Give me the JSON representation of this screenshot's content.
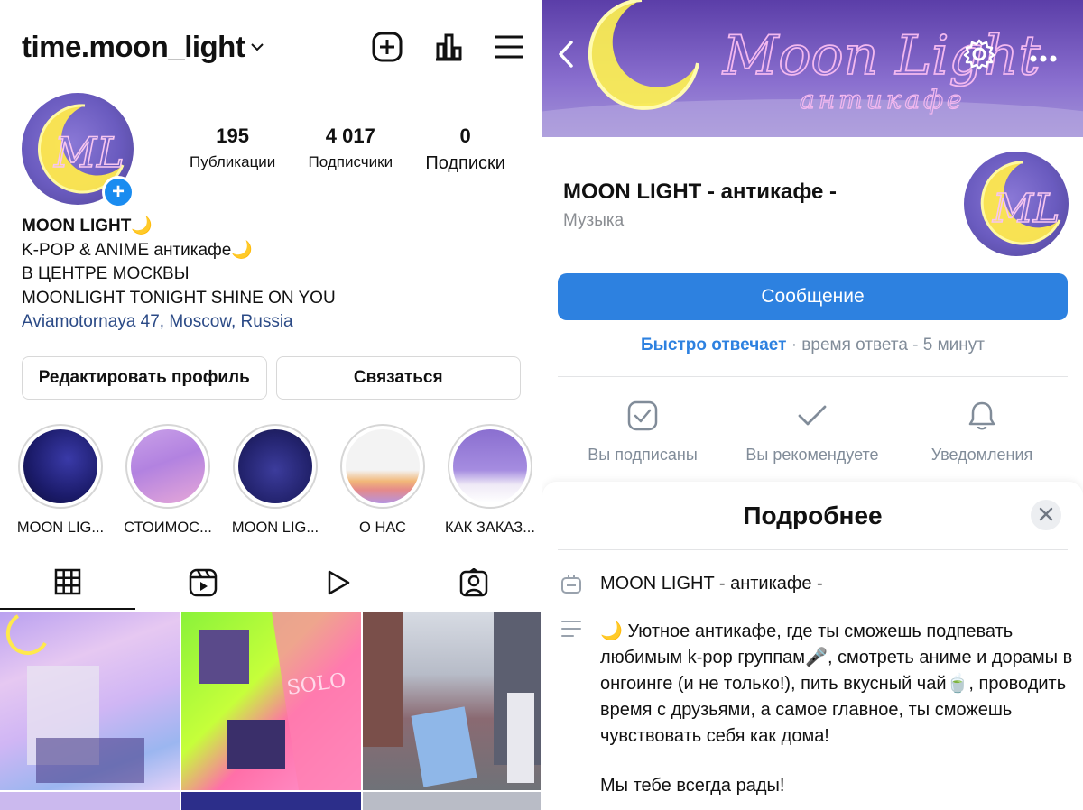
{
  "instagram": {
    "username": "time.moon_light",
    "stats": [
      {
        "value": "195",
        "label": "Публикации"
      },
      {
        "value": "4 017",
        "label": "Подписчики"
      },
      {
        "value": "0",
        "label": "Подписки"
      }
    ],
    "bio": {
      "name": "MOON LIGHT🌙",
      "line1": "K-POP & ANIME антикафе🌙",
      "line2": "В ЦЕНТРЕ МОСКВЫ",
      "line3": "MOONLIGHT TONIGHT SHINE ON YOU",
      "location": "Aviamotornaya 47, Moscow, Russia"
    },
    "buttons": {
      "edit": "Редактировать профиль",
      "contact": "Связаться"
    },
    "highlights": [
      {
        "title": "MOON LIG..."
      },
      {
        "title": "СТОИМОС..."
      },
      {
        "title": "MOON LIG..."
      },
      {
        "title": "О НАС"
      },
      {
        "title": "КАК ЗАКАЗ..."
      }
    ],
    "avatar_letters": "ML",
    "grid_texts": {
      "solo": "SOLO"
    }
  },
  "vk": {
    "cover_text": "Moon Light",
    "cover_sub": "антикафе",
    "name": "MOON LIGHT - антикафе -",
    "category": "Музыка",
    "message_button": "Сообщение",
    "reply_fast": "Быстро отвечает",
    "reply_time": " · время ответа - 5 минут",
    "actions": [
      {
        "label": "Вы подписаны",
        "icon": "check-square-icon"
      },
      {
        "label": "Вы рекомендуете",
        "icon": "check-icon"
      },
      {
        "label": "Уведомления",
        "icon": "bell-icon"
      }
    ],
    "sheet": {
      "title": "Подробнее",
      "name_row": "MOON LIGHT - антикафе -",
      "description": "🌙 Уютное антикафе, где ты сможешь подпевать любимым k-pop группам🎤, смотреть аниме и дорамы в онгоинге (и не только!), пить вкусный чай🍵, проводить время с друзьями, а самое главное, ты сможешь чувствовать себя как дома!",
      "greeting": "Мы тебе всегда рады!"
    },
    "colors": {
      "accent": "#2d81e0",
      "muted": "#818c99"
    }
  }
}
